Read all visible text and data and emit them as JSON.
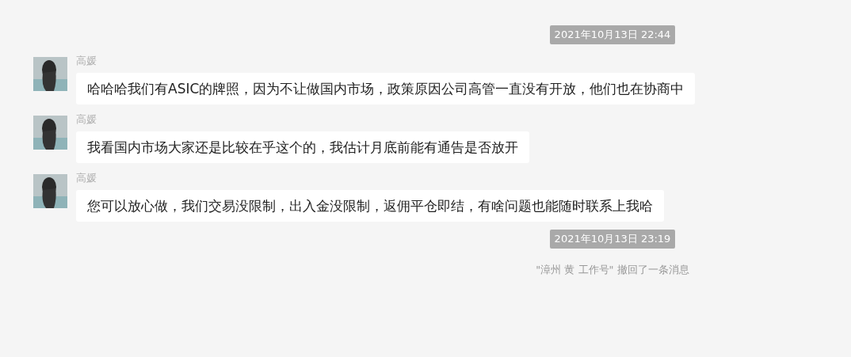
{
  "items": [
    {
      "kind": "time",
      "text": "2021年10月13日 22:44"
    },
    {
      "kind": "message",
      "sender": "高媛",
      "text": "哈哈哈我们有ASIC的牌照，因为不让做国内市场，政策原因公司高管一直没有开放，他们也在协商中"
    },
    {
      "kind": "message",
      "sender": "高媛",
      "text": "我看国内市场大家还是比较在乎这个的，我估计月底前能有通告是否放开"
    },
    {
      "kind": "message",
      "sender": "高媛",
      "text": "您可以放心做，我们交易没限制，出入金没限制，返佣平仓即结，有啥问题也能随时联系上我哈"
    },
    {
      "kind": "time",
      "text": "2021年10月13日 23:19"
    },
    {
      "kind": "notice",
      "text": "\"漳州 黄 工作号\" 撤回了一条消息"
    }
  ]
}
